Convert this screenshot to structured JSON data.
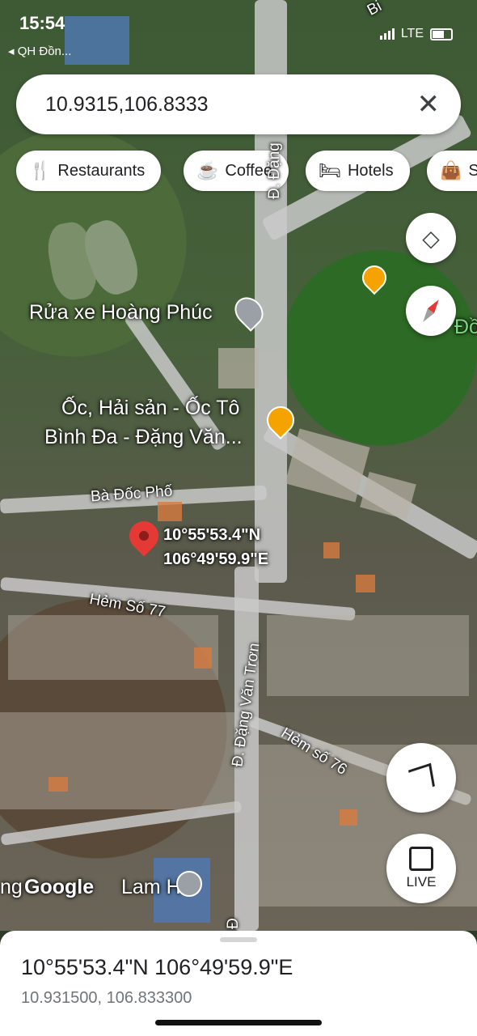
{
  "status_bar": {
    "time": "15:54",
    "back_app": "◂ QH Đồn...",
    "network": "LTE"
  },
  "search": {
    "query": "10.9315,106.8333"
  },
  "chips": [
    {
      "label": "Restaurants",
      "icon": "fork-knife-icon"
    },
    {
      "label": "Coffee",
      "icon": "coffee-cup-icon"
    },
    {
      "label": "Hotels",
      "icon": "bed-icon"
    },
    {
      "label": "S",
      "icon": "shopping-bag-icon"
    }
  ],
  "map": {
    "places": {
      "car_wash": "Rửa xe Hoàng Phúc",
      "restaurant_line1": "Ốc, Hải sản - Ốc Tô",
      "restaurant_line2": "Bình Đa - Đặng Văn...",
      "school": "Lam Hà",
      "right_edge": "Đồ",
      "left_edge": "ng"
    },
    "streets": {
      "ba_doc_pho": "Bà Đốc Phố",
      "hem_77": "Hẻm Số 77",
      "dang_van_tron": "Đ. Đặng Văn Trơn",
      "hem_76": "Hẻm số 76",
      "top_road": "Đ. Đặng",
      "top_right": "Bi",
      "bottom_road": "Đ"
    },
    "pin": {
      "lat_dms": "10°55'53.4\"N",
      "lng_dms": "106°49'59.9\"E"
    },
    "watermark": "Google",
    "live_label": "LIVE",
    "colors": {
      "pin": "#e53935",
      "food_marker": "#f4a300",
      "compass_red": "#e53935"
    }
  },
  "sheet": {
    "title": "10°55'53.4\"N 106°49'59.9\"E",
    "subtitle": "10.931500, 106.833300"
  }
}
